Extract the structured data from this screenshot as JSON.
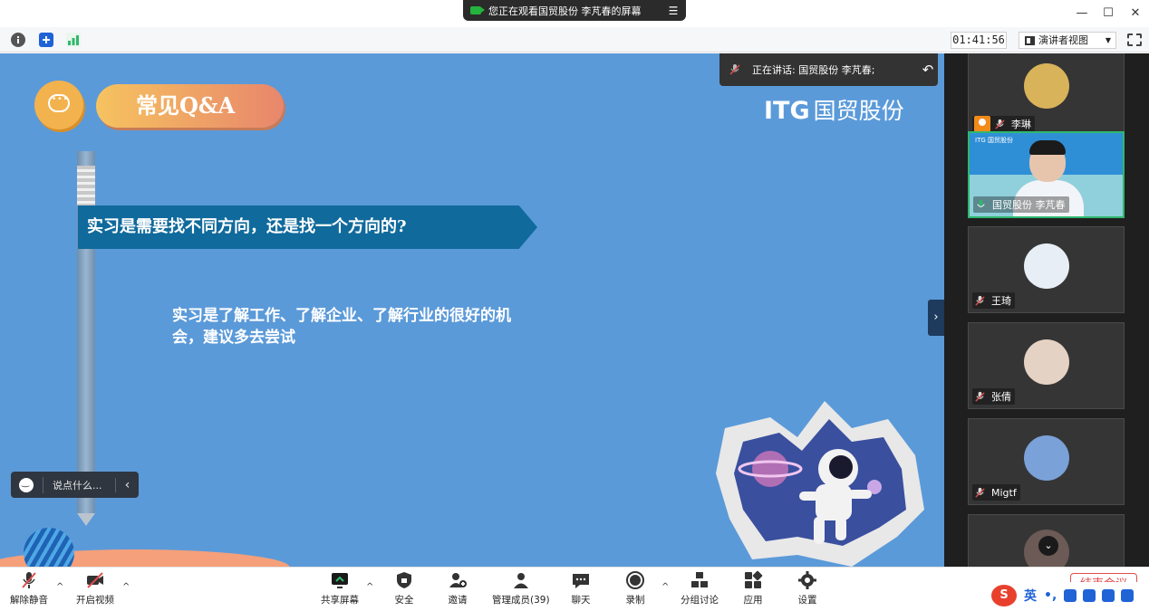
{
  "window": {
    "share_notice": "您正在观看国贸股份 李芃春的屏幕",
    "minimize_icon": "minimize-icon",
    "maximize_icon": "maximize-icon",
    "close_icon": "close-icon"
  },
  "infobar": {
    "timer": "01:41:56",
    "view_mode": "演讲者视图"
  },
  "slide": {
    "qa_title": "常见Q&A",
    "logo_latin": "ITG",
    "logo_cn": "国贸股份",
    "question": "实习是需要找不同方向，还是找一个方向的?",
    "answer": "实习是了解工作、了解企业、了解行业的很好的机会，建议多去尝试",
    "speaking": "正在讲话: 国贸股份 李芃春;",
    "chat_placeholder": "说点什么..."
  },
  "participants": [
    {
      "name": "李琳",
      "muted": true,
      "host": true,
      "avatar_color": "#d9b35a"
    },
    {
      "name": "国贸股份 李芃春",
      "muted": false,
      "video": true,
      "video_watermark": "ITG 国贸股份"
    },
    {
      "name": "王琦",
      "muted": true,
      "avatar_color": "#e8eef5"
    },
    {
      "name": "张倩",
      "muted": true,
      "avatar_color": "#e4d2c4"
    },
    {
      "name": "Migtf",
      "muted": true,
      "avatar_color": "#7aa1d8"
    }
  ],
  "toolbar": {
    "unmute": "解除静音",
    "start_video": "开启视频",
    "share_screen": "共享屏幕",
    "security": "安全",
    "invite": "邀请",
    "manage_members": "管理成员(39)",
    "chat": "聊天",
    "record": "录制",
    "breakout": "分组讨论",
    "apps": "应用",
    "settings": "设置",
    "end_meeting": "结束会议"
  },
  "ime": {
    "logo": "S",
    "lang": "英"
  },
  "colors": {
    "slide_bg": "#5b9ad9",
    "banner": "#106a9c",
    "accent_green": "#2fb86e",
    "end_red": "#e04d4d"
  }
}
